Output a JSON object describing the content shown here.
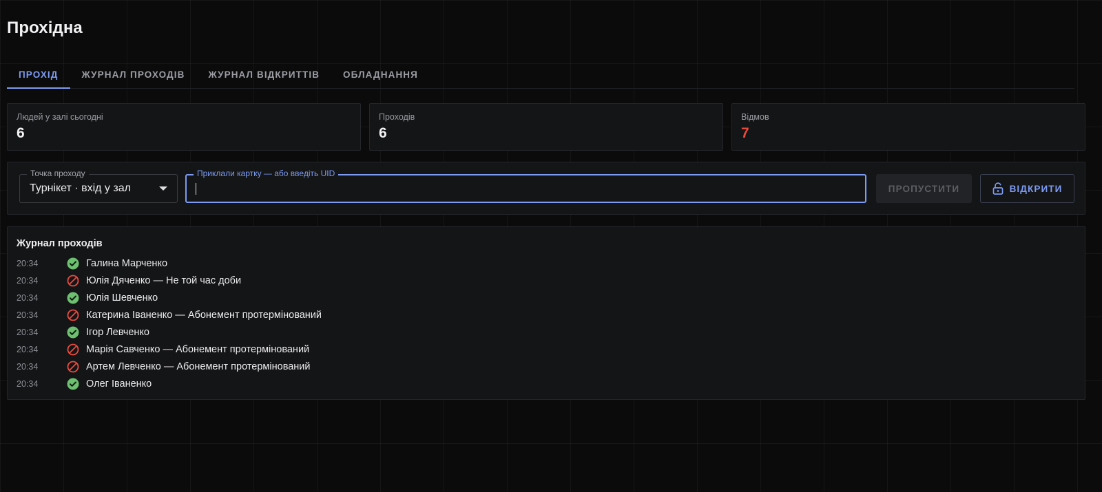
{
  "title": "Прохідна",
  "tabs": [
    {
      "label": "ПРОХІД",
      "active": true
    },
    {
      "label": "ЖУРНАЛ ПРОХОДІВ",
      "active": false
    },
    {
      "label": "ЖУРНАЛ ВІДКРИТТІВ",
      "active": false
    },
    {
      "label": "ОБЛАДНАННЯ",
      "active": false
    }
  ],
  "stats": [
    {
      "label": "Людей у залі сьогодні",
      "value": "6"
    },
    {
      "label": "Проходів",
      "value": "6"
    },
    {
      "label": "Відмов",
      "value": "7"
    }
  ],
  "controls": {
    "point_label": "Точка проходу",
    "point_value": "Турнікет · вхід у зал",
    "uid_label": "Приклали картку — або введіть UID",
    "uid_value": "",
    "pass_button": "ПРОПУСТИТИ",
    "open_button": "ВІДКРИТИ"
  },
  "log": {
    "heading": "Журнал проходів",
    "entries": [
      {
        "time": "20:34",
        "status": "allowed",
        "text": "Галина Марченко"
      },
      {
        "time": "20:34",
        "status": "denied",
        "text": "Юлія Дяченко — Не той час доби"
      },
      {
        "time": "20:34",
        "status": "allowed",
        "text": "Юлія Шевченко"
      },
      {
        "time": "20:34",
        "status": "denied",
        "text": "Катерина Іваненко — Абонемент протермінований"
      },
      {
        "time": "20:34",
        "status": "allowed",
        "text": "Ігор Левченко"
      },
      {
        "time": "20:34",
        "status": "denied",
        "text": "Марія Савченко — Абонемент протермінований"
      },
      {
        "time": "20:34",
        "status": "denied",
        "text": "Артем Левченко — Абонемент протермінований"
      },
      {
        "time": "20:34",
        "status": "allowed",
        "text": "Олег Іваненко"
      }
    ]
  },
  "colors": {
    "accent": "#7d9bf2",
    "danger": "#ea4b3e",
    "success": "#6cc070",
    "background": "#0b0b0c",
    "panel": "#141517"
  }
}
